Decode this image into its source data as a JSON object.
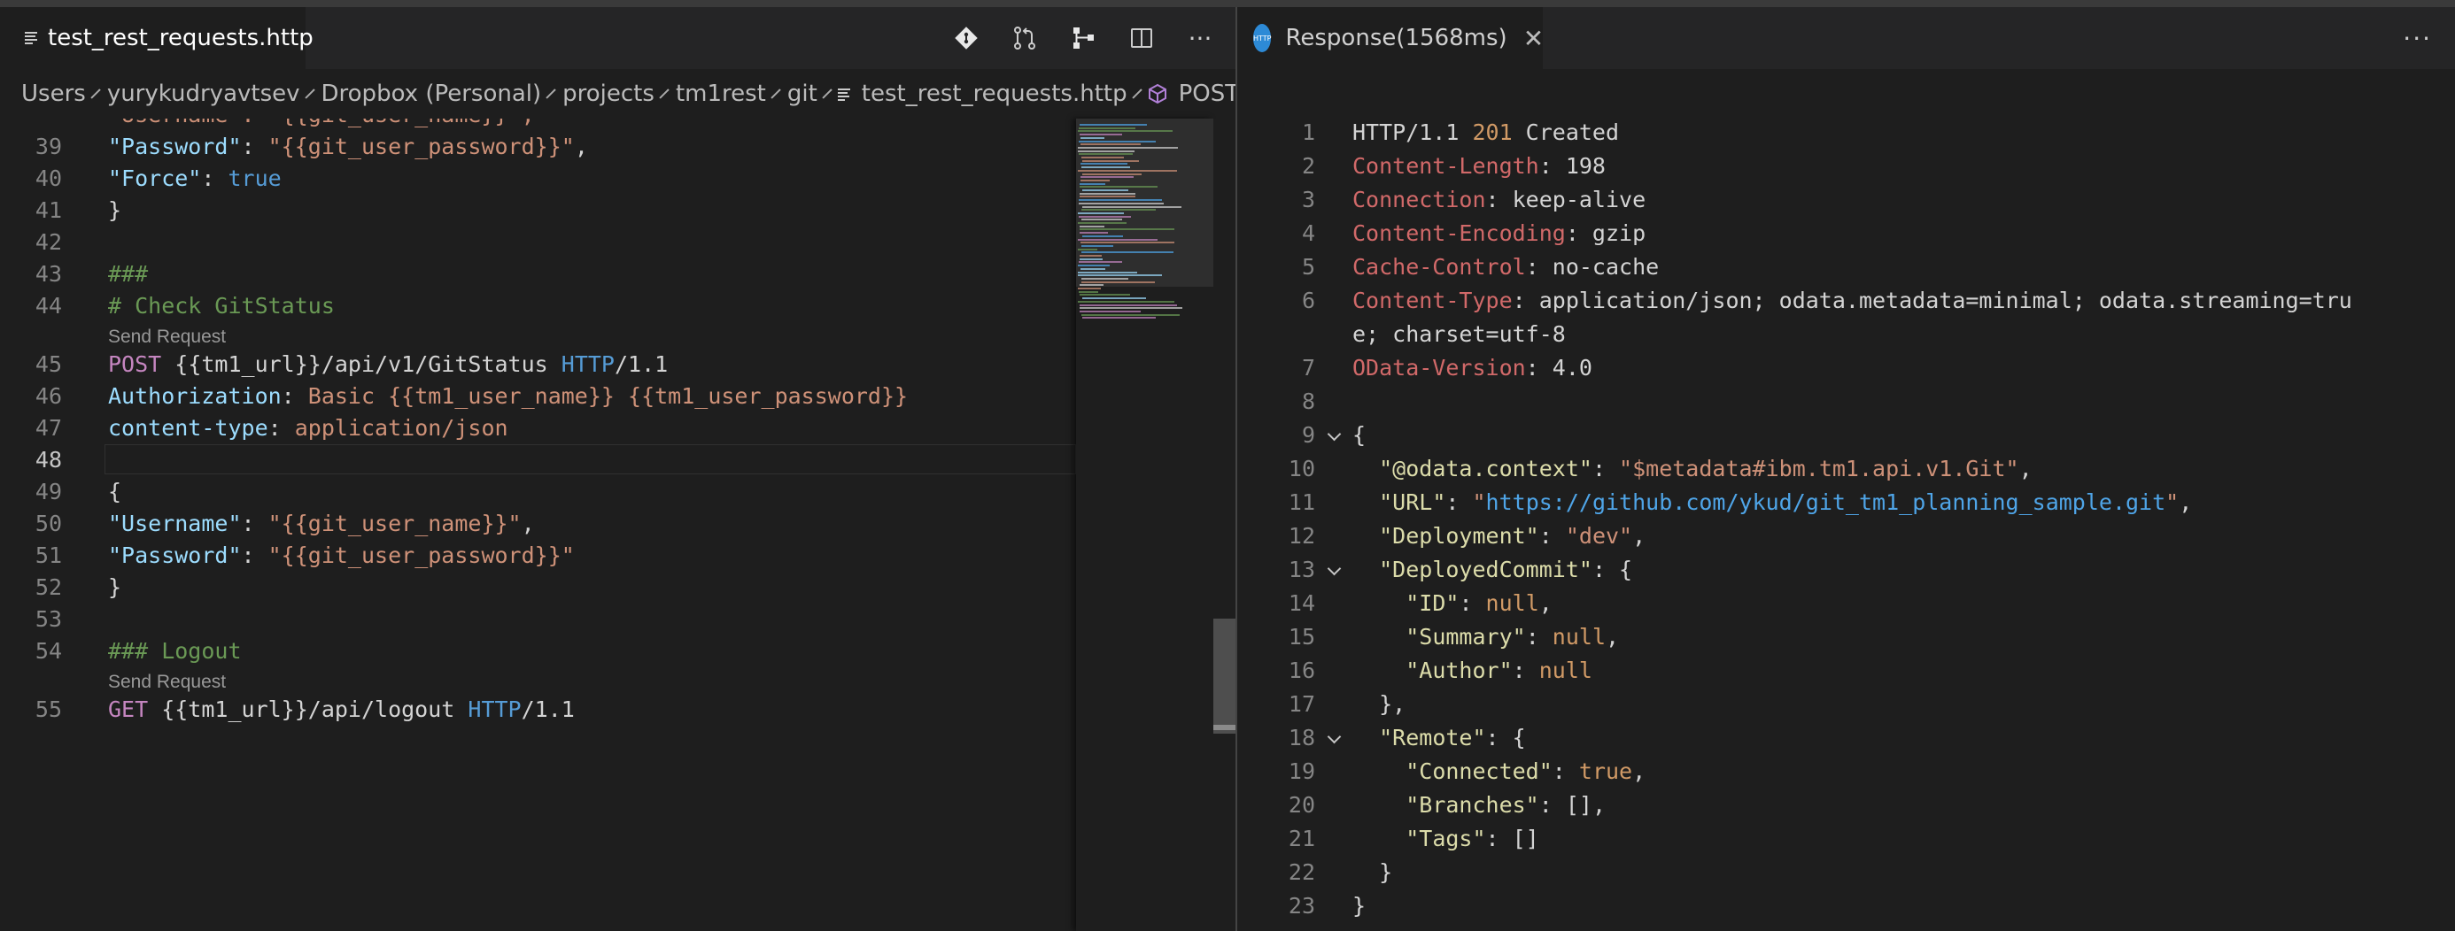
{
  "left_editor": {
    "tab": {
      "label": "test_rest_requests.http"
    },
    "actions": [
      "git-compare-icon",
      "pull-request-icon",
      "source-control-graph-icon",
      "split-editor-icon",
      "more-actions-icon"
    ],
    "more_label": "···",
    "breadcrumb": [
      "Users",
      "yurykudryavtsev",
      "Dropbox (Personal)",
      "projects",
      "tm1rest",
      "git",
      "test_rest_requests.http",
      "POST /ap"
    ],
    "partial_top_line": "\"Username\": \"{{git_user_name}}\",",
    "lines": [
      {
        "n": "39",
        "tokens": [
          [
            "key",
            "\"Password\""
          ],
          [
            "txt",
            ": "
          ],
          [
            "str",
            "\"{{git_user_password}}\""
          ],
          [
            "txt",
            ","
          ]
        ]
      },
      {
        "n": "40",
        "tokens": [
          [
            "key",
            "\"Force\""
          ],
          [
            "txt",
            ": "
          ],
          [
            "bool",
            "true"
          ]
        ]
      },
      {
        "n": "41",
        "tokens": [
          [
            "txt",
            "}"
          ]
        ]
      },
      {
        "n": "42",
        "tokens": []
      },
      {
        "n": "43",
        "tokens": [
          [
            "comment",
            "###"
          ]
        ]
      },
      {
        "n": "44",
        "tokens": [
          [
            "comment",
            "# Check GitStatus"
          ]
        ],
        "lens_after": "Send Request"
      },
      {
        "n": "45",
        "tokens": [
          [
            "method",
            "POST"
          ],
          [
            "txt",
            " {{tm1_url}}/api/v1/GitStatus "
          ],
          [
            "http",
            "HTTP"
          ],
          [
            "txt",
            "/1.1"
          ]
        ]
      },
      {
        "n": "46",
        "tokens": [
          [
            "hdr",
            "Authorization"
          ],
          [
            "txt",
            ": "
          ],
          [
            "hval",
            "Basic {{tm1_user_name}} {{tm1_user_password}}"
          ]
        ]
      },
      {
        "n": "47",
        "tokens": [
          [
            "hdr",
            "content-type"
          ],
          [
            "txt",
            ": "
          ],
          [
            "hval",
            "application/json"
          ]
        ]
      },
      {
        "n": "48",
        "tokens": [],
        "current": true
      },
      {
        "n": "49",
        "tokens": [
          [
            "txt",
            "{"
          ]
        ]
      },
      {
        "n": "50",
        "tokens": [
          [
            "key",
            "\"Username\""
          ],
          [
            "txt",
            ": "
          ],
          [
            "str",
            "\"{{git_user_name}}\""
          ],
          [
            "txt",
            ","
          ]
        ]
      },
      {
        "n": "51",
        "tokens": [
          [
            "key",
            "\"Password\""
          ],
          [
            "txt",
            ": "
          ],
          [
            "str",
            "\"{{git_user_password}}\""
          ]
        ]
      },
      {
        "n": "52",
        "tokens": [
          [
            "txt",
            "}"
          ]
        ]
      },
      {
        "n": "53",
        "tokens": []
      },
      {
        "n": "54",
        "tokens": [
          [
            "comment",
            "### Logout"
          ]
        ],
        "lens_after": "Send Request"
      },
      {
        "n": "55",
        "tokens": [
          [
            "method",
            "GET"
          ],
          [
            "txt",
            " {{tm1_url}}/api/logout "
          ],
          [
            "http",
            "HTTP"
          ],
          [
            "txt",
            "/1.1"
          ]
        ]
      }
    ]
  },
  "right_panel": {
    "tab": {
      "label": "Response(1568ms)",
      "icon": "rest-client-icon",
      "icon_text": "HTTP"
    },
    "more_label": "···",
    "lines": [
      {
        "n": "1",
        "tokens": [
          [
            "def",
            "HTTP/1.1 "
          ],
          [
            "status",
            "201"
          ],
          [
            "def",
            " Created"
          ]
        ]
      },
      {
        "n": "2",
        "tokens": [
          [
            "hkey",
            "Content-Length"
          ],
          [
            "def",
            ": 198"
          ]
        ]
      },
      {
        "n": "3",
        "tokens": [
          [
            "hkey",
            "Connection"
          ],
          [
            "def",
            ": keep-alive"
          ]
        ]
      },
      {
        "n": "4",
        "tokens": [
          [
            "hkey",
            "Content-Encoding"
          ],
          [
            "def",
            ": gzip"
          ]
        ]
      },
      {
        "n": "5",
        "tokens": [
          [
            "hkey",
            "Cache-Control"
          ],
          [
            "def",
            ": no-cache"
          ]
        ]
      },
      {
        "n": "6",
        "tokens": [
          [
            "hkey",
            "Content-Type"
          ],
          [
            "def",
            ": application/json; odata.metadata=minimal; odata.streaming=tru"
          ]
        ]
      },
      {
        "n": "",
        "tokens": [
          [
            "def",
            "e; charset=utf-8"
          ]
        ]
      },
      {
        "n": "7",
        "tokens": [
          [
            "hkey",
            "OData-Version"
          ],
          [
            "def",
            ": 4.0"
          ]
        ]
      },
      {
        "n": "8",
        "tokens": []
      },
      {
        "n": "9",
        "fold": true,
        "tokens": [
          [
            "def",
            "{"
          ]
        ]
      },
      {
        "n": "10",
        "tokens": [
          [
            "def",
            "  "
          ],
          [
            "jkey",
            "\"@odata.context\""
          ],
          [
            "def",
            ": "
          ],
          [
            "jstr",
            "\"$metadata#ibm.tm1.api.v1.Git\""
          ],
          [
            "def",
            ","
          ]
        ]
      },
      {
        "n": "11",
        "tokens": [
          [
            "def",
            "  "
          ],
          [
            "jkey",
            "\"URL\""
          ],
          [
            "def",
            ": "
          ],
          [
            "jstr",
            "\""
          ],
          [
            "url",
            "https://github.com/ykud/git_tm1_planning_sample.git"
          ],
          [
            "jstr",
            "\""
          ],
          [
            "def",
            ","
          ]
        ]
      },
      {
        "n": "12",
        "tokens": [
          [
            "def",
            "  "
          ],
          [
            "jkey",
            "\"Deployment\""
          ],
          [
            "def",
            ": "
          ],
          [
            "jstr",
            "\"dev\""
          ],
          [
            "def",
            ","
          ]
        ]
      },
      {
        "n": "13",
        "fold": true,
        "tokens": [
          [
            "def",
            "  "
          ],
          [
            "jkey",
            "\"DeployedCommit\""
          ],
          [
            "def",
            ": {"
          ]
        ]
      },
      {
        "n": "14",
        "tokens": [
          [
            "def",
            "    "
          ],
          [
            "jkey",
            "\"ID\""
          ],
          [
            "def",
            ": "
          ],
          [
            "null",
            "null"
          ],
          [
            "def",
            ","
          ]
        ]
      },
      {
        "n": "15",
        "tokens": [
          [
            "def",
            "    "
          ],
          [
            "jkey",
            "\"Summary\""
          ],
          [
            "def",
            ": "
          ],
          [
            "null",
            "null"
          ],
          [
            "def",
            ","
          ]
        ]
      },
      {
        "n": "16",
        "tokens": [
          [
            "def",
            "    "
          ],
          [
            "jkey",
            "\"Author\""
          ],
          [
            "def",
            ": "
          ],
          [
            "null",
            "null"
          ]
        ]
      },
      {
        "n": "17",
        "tokens": [
          [
            "def",
            "  },"
          ]
        ]
      },
      {
        "n": "18",
        "fold": true,
        "tokens": [
          [
            "def",
            "  "
          ],
          [
            "jkey",
            "\"Remote\""
          ],
          [
            "def",
            ": {"
          ]
        ]
      },
      {
        "n": "19",
        "tokens": [
          [
            "def",
            "    "
          ],
          [
            "jkey",
            "\"Connected\""
          ],
          [
            "def",
            ": "
          ],
          [
            "bool",
            "true"
          ],
          [
            "def",
            ","
          ]
        ]
      },
      {
        "n": "20",
        "tokens": [
          [
            "def",
            "    "
          ],
          [
            "jkey",
            "\"Branches\""
          ],
          [
            "def",
            ": [],"
          ]
        ]
      },
      {
        "n": "21",
        "tokens": [
          [
            "def",
            "    "
          ],
          [
            "jkey",
            "\"Tags\""
          ],
          [
            "def",
            ": []"
          ]
        ]
      },
      {
        "n": "22",
        "tokens": [
          [
            "def",
            "  }"
          ]
        ]
      },
      {
        "n": "23",
        "tokens": [
          [
            "def",
            "}"
          ]
        ]
      }
    ]
  },
  "colors": {
    "background": "#1e1e1e",
    "tabbar": "#252526",
    "json_key": "#dcdcaa",
    "string": "#ce9178",
    "url": "#4fa5e8",
    "header_key": "#d16969",
    "comment": "#6a9955",
    "method": "#c586c0"
  }
}
